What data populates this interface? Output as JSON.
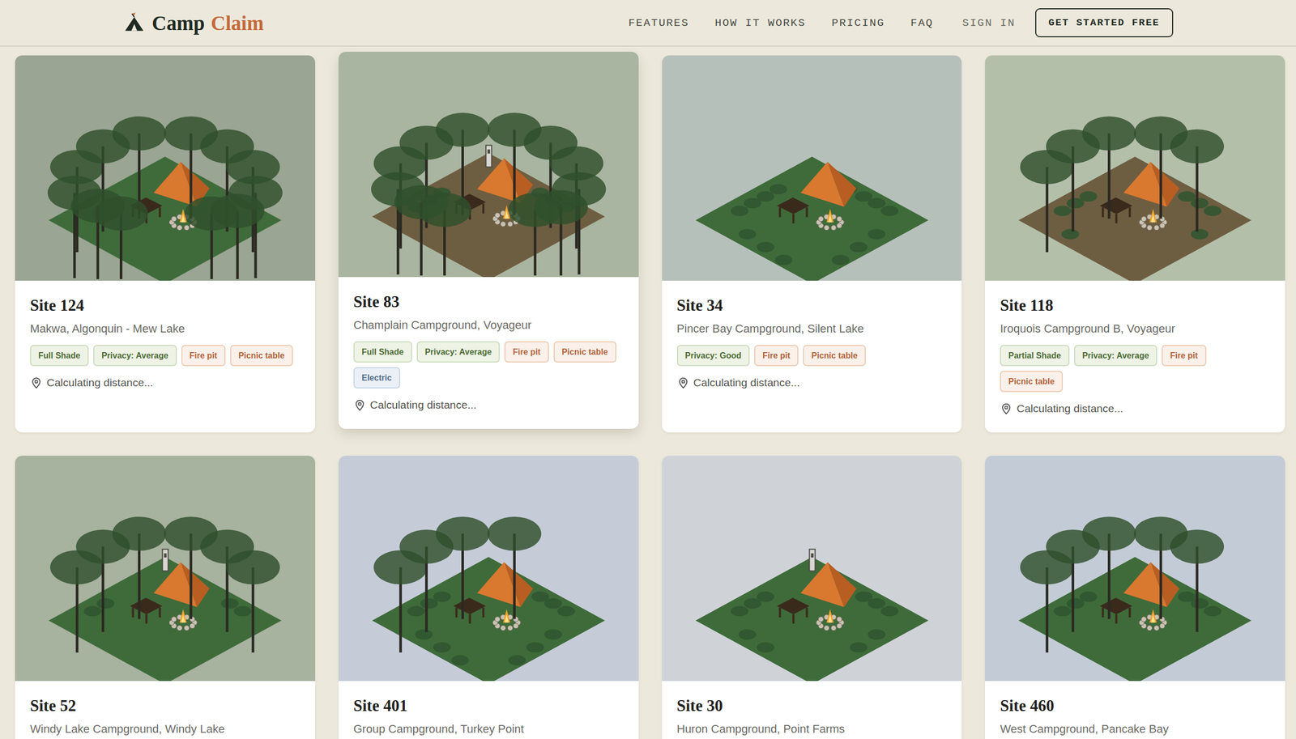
{
  "nav": {
    "logo": {
      "first": "Camp",
      "second": "Claim"
    },
    "links": [
      "FEATURES",
      "HOW IT WORKS",
      "PRICING",
      "FAQ"
    ],
    "sign_in": "SIGN IN",
    "cta": "GET STARTED FREE"
  },
  "sites": [
    {
      "title": "Site 124",
      "location": "Makwa, Algonquin - Mew Lake",
      "hovered": false,
      "photo_color": "#9aa593",
      "illustration": {
        "ground_color": "#3f6b3a",
        "trees": 12,
        "bushes": 0,
        "post": false
      },
      "tags": [
        {
          "label": "Full Shade",
          "kind": "condition"
        },
        {
          "label": "Privacy: Average",
          "kind": "condition"
        },
        {
          "label": "Fire pit",
          "kind": "amenity"
        },
        {
          "label": "Picnic table",
          "kind": "amenity"
        }
      ],
      "distance": "Calculating distance..."
    },
    {
      "title": "Site 83",
      "location": "Champlain Campground, Voyageur",
      "hovered": true,
      "photo_color": "#a9b5a0",
      "illustration": {
        "ground_color": "#6e5e41",
        "trees": 12,
        "bushes": 6,
        "post": true
      },
      "tags": [
        {
          "label": "Full Shade",
          "kind": "condition"
        },
        {
          "label": "Privacy: Average",
          "kind": "condition"
        },
        {
          "label": "Fire pit",
          "kind": "amenity"
        },
        {
          "label": "Picnic table",
          "kind": "amenity"
        },
        {
          "label": "Electric",
          "kind": "utility"
        }
      ],
      "distance": "Calculating distance..."
    },
    {
      "title": "Site 34",
      "location": "Pincer Bay Campground, Silent Lake",
      "hovered": false,
      "photo_color": "#b6c0bb",
      "illustration": {
        "ground_color": "#3f6b3a",
        "trees": 0,
        "bushes": 14,
        "post": false
      },
      "tags": [
        {
          "label": "Privacy: Good",
          "kind": "condition"
        },
        {
          "label": "Fire pit",
          "kind": "amenity"
        },
        {
          "label": "Picnic table",
          "kind": "amenity"
        }
      ],
      "distance": "Calculating distance..."
    },
    {
      "title": "Site 118",
      "location": "Iroquois Campground B, Voyageur",
      "hovered": false,
      "photo_color": "#b4bfaa",
      "illustration": {
        "ground_color": "#6e5e41",
        "trees": 5,
        "bushes": 8,
        "post": false
      },
      "tags": [
        {
          "label": "Partial Shade",
          "kind": "condition"
        },
        {
          "label": "Privacy: Average",
          "kind": "condition"
        },
        {
          "label": "Fire pit",
          "kind": "amenity"
        },
        {
          "label": "Picnic table",
          "kind": "amenity"
        }
      ],
      "distance": "Calculating distance..."
    },
    {
      "title": "Site 52",
      "location": "Windy Lake Campground, Windy Lake",
      "hovered": false,
      "photo_color": "#a7b29f",
      "illustration": {
        "ground_color": "#3f6b3a",
        "trees": 6,
        "bushes": 4,
        "post": true
      },
      "tags": []
    },
    {
      "title": "Site 401",
      "location": "Group Campground, Turkey Point",
      "hovered": false,
      "photo_color": "#c5ccd8",
      "illustration": {
        "ground_color": "#3f6b3a",
        "trees": 4,
        "bushes": 12,
        "post": false
      },
      "tags": []
    },
    {
      "title": "Site 30",
      "location": "Huron Campground, Point Farms",
      "hovered": false,
      "photo_color": "#cfd3d8",
      "illustration": {
        "ground_color": "#3f6b3a",
        "trees": 0,
        "bushes": 10,
        "post": true
      },
      "tags": []
    },
    {
      "title": "Site 460",
      "location": "West Campground, Pancake Bay",
      "hovered": false,
      "photo_color": "#c3ccd6",
      "illustration": {
        "ground_color": "#3f6b3a",
        "trees": 5,
        "bushes": 6,
        "post": false
      },
      "tags": []
    }
  ]
}
